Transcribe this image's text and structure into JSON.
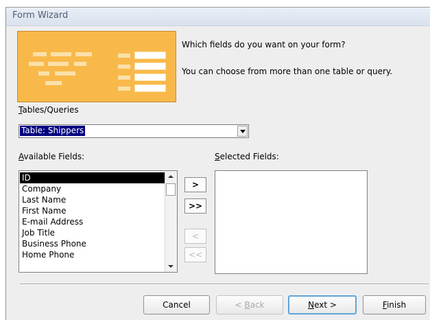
{
  "window": {
    "title": "Form Wizard"
  },
  "prompt": {
    "question": "Which fields do you want on your form?",
    "hint": "You can choose from more than one table or query."
  },
  "tables_queries": {
    "label": "Tables/Queries",
    "selected": "Table: Shippers"
  },
  "available_fields": {
    "label": "Available Fields:",
    "items": [
      "ID",
      "Company",
      "Last Name",
      "First Name",
      "E-mail Address",
      "Job Title",
      "Business Phone",
      "Home Phone"
    ],
    "selected_index": 0
  },
  "selected_fields": {
    "label": "Selected Fields:",
    "items": []
  },
  "move_buttons": {
    "add_one": ">",
    "add_all": ">>",
    "remove_one": "<",
    "remove_all": "<<"
  },
  "footer": {
    "cancel": "Cancel",
    "back": "< Back",
    "next": "Next >",
    "finish": "Finish"
  },
  "colors": {
    "illustration": "#f8b94a",
    "selection": "#000000",
    "default_button_border": "#5fa5d8"
  }
}
